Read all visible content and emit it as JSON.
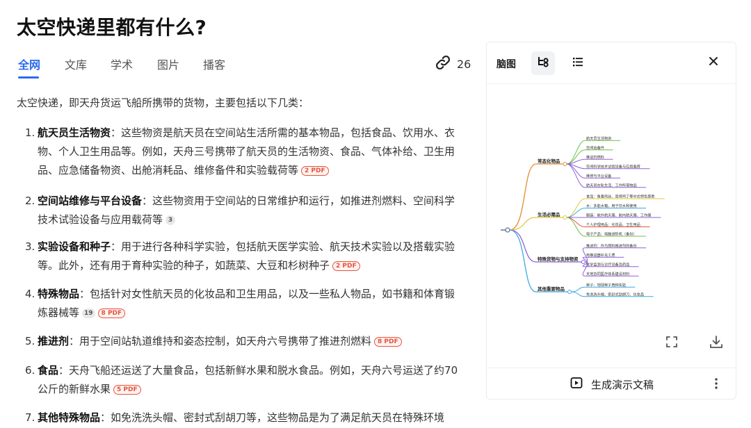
{
  "page": {
    "title": "太空快递里都有什么?"
  },
  "tabs": [
    {
      "label": "全网",
      "active": true
    },
    {
      "label": "文库",
      "active": false
    },
    {
      "label": "学术",
      "active": false
    },
    {
      "label": "图片",
      "active": false
    },
    {
      "label": "播客",
      "active": false
    }
  ],
  "sources": {
    "count": "26",
    "icon": "link-icon"
  },
  "answer": {
    "intro": "太空快递，即天舟货运飞船所携带的货物，主要包括以下几类：",
    "items": [
      {
        "num": "1.",
        "title": "航天员生活物资",
        "text": "：这些物资是航天员在空间站生活所需的基本物品，包括食品、饮用水、衣物、个人卫生用品等。例如，天舟三号携带了航天员的生活物资、食品、气体补给、卫生用品、应急储备物资、出舱消耗品、维修备件和实验载荷等",
        "cite": "",
        "pdf": "2 PDF"
      },
      {
        "num": "2.",
        "title": "空间站维修与平台设备",
        "text": "：这些物资用于空间站的日常维护和运行，如推进剂燃料、空间科学技术试验设备与应用载荷等",
        "cite": "3",
        "pdf": ""
      },
      {
        "num": "3.",
        "title": "实验设备和种子",
        "text": "：用于进行各种科学实验，包括航天医学实验、航天技术实验以及搭载实验等。此外，还有用于育种实验的种子，如蔬菜、大豆和杉树种子",
        "cite": "",
        "pdf": "2 PDF"
      },
      {
        "num": "4.",
        "title": "特殊物品",
        "text": "：包括针对女性航天员的化妆品和卫生用品，以及一些私人物品，如书籍和体育锻炼器械等",
        "cite": "19",
        "pdf": "8 PDF"
      },
      {
        "num": "5.",
        "title": "推进剂",
        "text": "：用于空间站轨道维持和姿态控制，如天舟六号携带了推进剂燃料",
        "cite": "",
        "pdf": "8 PDF"
      },
      {
        "num": "6.",
        "title": "食品",
        "text": "：天舟飞船还运送了大量食品，包括新鲜水果和脱水食品。例如，天舟六号运送了约70公斤的新鲜水果",
        "cite": "",
        "pdf": "5 PDF"
      },
      {
        "num": "7.",
        "title": "其他特殊物品",
        "text": "：如免洗洗头帽、密封式刮胡刀等，这些物品是为了满足航天员在特殊环境",
        "cite": "",
        "pdf": ""
      }
    ]
  },
  "panel": {
    "label": "脑图",
    "mindmap_icon": "mindmap-view-icon",
    "list_icon": "list-view-icon",
    "close_icon": "close-icon",
    "fullscreen_icon": "fullscreen-icon",
    "download_icon": "download-icon",
    "generate_label": "生成演示文稿",
    "generate_icon": "play-slides-icon",
    "more_icon": "more-vertical-icon"
  },
  "mindmap": {
    "branches": [
      {
        "label": "常态化物品",
        "color": "#e58b2e",
        "leaves": [
          "航天员生活物资",
          "空间站备件",
          "推进剂燃料",
          "空间科学技术试验设备与应用载荷",
          "维修与平台设备",
          "航天员在轨生活、工作所需物品"
        ],
        "leaf_colors": [
          "#6cc04a",
          "#6cc04a",
          "#8f62d6",
          "#8f62d6",
          "#8f62d6",
          "#8f62d6"
        ]
      },
      {
        "label": "生活必需品",
        "color": "#e0c838",
        "leaves": [
          "食品：鱼香肉丝、宫保鸡丁等中式特色菜肴",
          "水：多能水箱，用于饮水和使用",
          "服装：舱外航天服、舱内航天服、工作服",
          "个人护理用品：化妆品、卫生用品",
          "电子产品：电脑进阶机（备份）"
        ],
        "leaf_colors": [
          "#e0c838",
          "#3da9e0",
          "#8f62d6",
          "#e5533d",
          "#6cc04a"
        ]
      },
      {
        "label": "特殊货物与支持物资",
        "color": "#8f62d6",
        "leaves": [
          "推进剂：作为燃料推进剂的备份",
          "电推进器补充工质",
          "医学监测与诊疗设备及药品",
          "天地协同医疗体系建设材料"
        ],
        "leaf_colors": [
          "#8f62d6",
          "#8f62d6",
          "#8f62d6",
          "#8f62d6"
        ]
      },
      {
        "label": "其他重要物品",
        "color": "#3da9e0",
        "leaves": [
          "种子：地球种子育种实验",
          "免洗洗头帽、密封式刮胡刀、化妆品"
        ],
        "leaf_colors": [
          "#3da9e0",
          "#3da9e0"
        ]
      }
    ]
  }
}
